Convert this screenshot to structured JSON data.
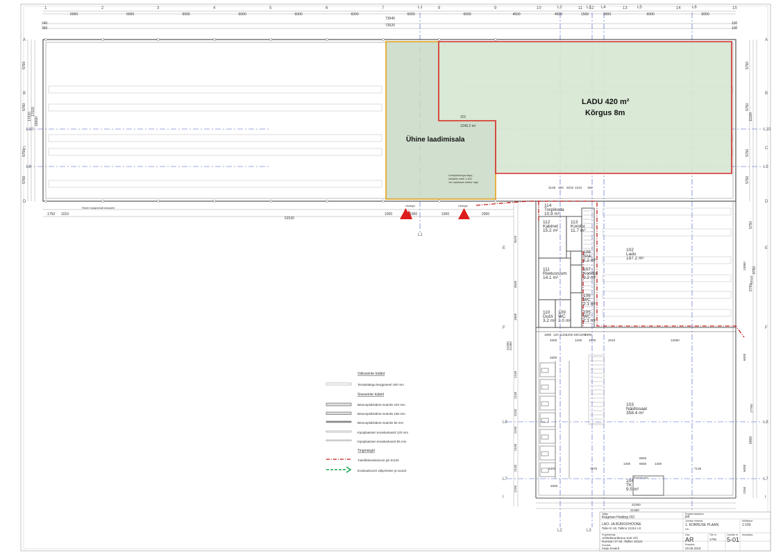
{
  "drawing": {
    "col_grid": [
      "1",
      "2",
      "3",
      "4",
      "5",
      "6",
      "7",
      "8",
      "9",
      "10",
      "11",
      "12",
      "13",
      "14",
      "15"
    ],
    "axis_labels": {
      "l1": "L1",
      "l2": "L2",
      "l3": "L3",
      "l4": "L4",
      "l5": "L5",
      "l6": "L6",
      "l7": "L7",
      "l8": "L8",
      "l9": "L9",
      "l10": "L10"
    },
    "row_grid": [
      "A",
      "B",
      "C",
      "D",
      "E",
      "F",
      "G",
      "H",
      "I"
    ],
    "top_dims": [
      "6000",
      "6000",
      "6000",
      "6000",
      "6000",
      "6000",
      "6000",
      "6000",
      "4500",
      "4500",
      "1500",
      "3000",
      "6000",
      "6000"
    ],
    "overall_dims": [
      "73940",
      "73520",
      "240",
      "360",
      "100",
      "100"
    ],
    "bottom_dims": [
      "1750",
      "1010",
      "52530",
      "1000",
      "1000",
      "1000",
      "2000"
    ],
    "bottom_notes": [
      "Redel maapinnalt katusele",
      "Uksega",
      "Uksega"
    ],
    "left_dims": [
      "5750",
      "5750",
      "5750",
      "5750",
      "17010",
      "17010",
      "16600"
    ],
    "right_dims": [
      "5750",
      "5750",
      "11100",
      "5750",
      "5750",
      "5750",
      "6750",
      "6750",
      "6000"
    ],
    "lower_left_dims": [
      "5010",
      "4840",
      "1800",
      "21000",
      "21360",
      "2150",
      "2155",
      "2150",
      "2150",
      "2155",
      "2150",
      "2150"
    ],
    "lower_right_dims": [
      "13060",
      "49110",
      "6000",
      "17750",
      "6000",
      "2250"
    ],
    "lower_bottom_dims": [
      "21000",
      "21360",
      "1300",
      "6550",
      "1300",
      "6550",
      "7125"
    ],
    "mid_dims": [
      "1890",
      "120",
      "1120",
      "1200",
      "190",
      "1200",
      "1890",
      "3300",
      "1200",
      "1900",
      "2010",
      "12590",
      "3300"
    ],
    "core_dims": [
      "3148",
      "120",
      "2010",
      "1210",
      "150"
    ],
    "misc_dims": [
      "2300",
      "7675",
      "2000"
    ],
    "highlight_main": {
      "title": "LADU 420 m²",
      "subtitle": "Kõrgus 8m"
    },
    "highlight_shared": {
      "title": "Ühine laadimisala",
      "number": "101",
      "area": "1245.2 m²"
    },
    "ladder_note": [
      "Liivapüüduriga trapp,",
      "lokaalne kalle 1:100",
      "1m raadiuses ümber trapi"
    ],
    "rooms": [
      {
        "no": "114",
        "name": "Trepikoda",
        "area": "10.9 m²"
      },
      {
        "no": "112",
        "name": "Kabinet",
        "area": "15.2 m²"
      },
      {
        "no": "113",
        "name": "Koridor",
        "area": "11.7 m²"
      },
      {
        "no": "108",
        "name": "Sisk",
        "area": "2.2 m²"
      },
      {
        "no": "107",
        "name": "Koridor",
        "area": "3.2 m²"
      },
      {
        "no": "111",
        "name": "Riietusruum",
        "area": "14.1 m²"
      },
      {
        "no": "106",
        "name": "WC",
        "area": "2.1 m²"
      },
      {
        "no": "110",
        "name": "Dušš",
        "area": "3.2 m²"
      },
      {
        "no": "109",
        "name": "WC",
        "area": "2.0 m²"
      },
      {
        "no": "105",
        "name": "WC",
        "area": "2.1 m²"
      },
      {
        "no": "102",
        "name": "Ladu",
        "area": "197.2 m²"
      },
      {
        "no": "103",
        "name": "Näidissaal",
        "area": "358.4 m²"
      },
      {
        "no": "104",
        "name": "TK",
        "area": "9.5 m²"
      }
    ],
    "small_tags": {
      "pump": "Pumpe/l silm"
    }
  },
  "legend": {
    "exterior_heading": "Välisseinte tüübid",
    "exterior": [
      "Teraskattega kergpaneel 190 mm"
    ],
    "interior_heading": "Siseseinte tüübid",
    "interior": [
      "Betoonplokkidest müüritis 240 mm",
      "Betoonplokkidest müüritis 190 mm",
      "Betoonplokkidest müüritis 90 mm",
      "Kipsplaatsein teraskarkassil 120 mm",
      "Kipsplaatsein teraskarkassil 95 mm"
    ],
    "symbols_heading": "Tingmärgid",
    "symbols": [
      "Tuletõkkesektsiooni piir EI120",
      "Evakuatsiooni väljumistee ja suund"
    ]
  },
  "title_block": {
    "client_label": "Tellija",
    "client": "Klugman Holding OÜ",
    "project": "LAO- JA BÜROOHOONE",
    "address": "Tahe tn 18, Tallinn 11314 LS",
    "designer_label": "Projekteerija",
    "designer": "Arhitektuuribüroo KvK OÜ",
    "designer_address": "Gonsiori 17-34, Tallinn 10124",
    "author_label": "Koostas",
    "author": "Katju Kivaird",
    "stage_label": "Projekti staadium",
    "stage": "PP",
    "sheet_label": "Joonise nimetus",
    "sheet_title": "1. KORRUSE PLAAN",
    "sheet_sub": "LB",
    "scale_label": "Mõõtkava",
    "scale": "1:100",
    "part_label": "Osa",
    "part": "AR",
    "work_label": "Töö nr",
    "work_no": "1706",
    "drawing_label": "Joonise nr",
    "drawing_no": "5-01",
    "date_label": "Kuupäev",
    "date": "20.06.2018",
    "revision_label": "Muudatus"
  },
  "colors": {
    "highlight_fill": "#c8dcc8",
    "main_border": "#d42a2a",
    "shared_border": "#e3a21a",
    "fire_line": "#c01818",
    "evac_line": "#16a34a",
    "gridline": "#3a50c8"
  }
}
